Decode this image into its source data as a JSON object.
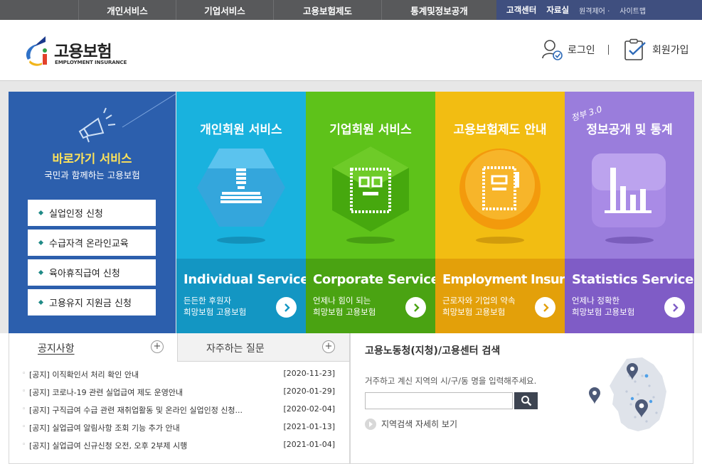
{
  "topnav": {
    "items": [
      "개인서비스",
      "기업서비스",
      "고용보험제도",
      "통계및정보공개"
    ],
    "util": {
      "customer": "고객센터",
      "data": "자료실",
      "remote": "원격제어",
      "sitemap": "사이트맵"
    }
  },
  "header": {
    "logo_ko": "고용보험",
    "logo_en": "EMPLOYMENT INSURANCE",
    "login": "로그인",
    "join": "회원가입"
  },
  "quick": {
    "title": "바로가기 서비스",
    "subtitle": "국민과 함께하는 고용보험",
    "buttons": [
      "실업인정 신청",
      "수급자격 온라인교육",
      "육아휴직급여 신청",
      "고용유지 지원금 신청"
    ]
  },
  "cards": [
    {
      "ko": "개인회원 서비스",
      "en": "Individual Service",
      "d1": "든든한 후원자",
      "d2": "희망보험 고용보험"
    },
    {
      "ko": "기업회원 서비스",
      "en": "Corporate Service",
      "d1": "언제나 힘이 되는",
      "d2": "희망보험 고용보험"
    },
    {
      "ko": "고용보험제도 안내",
      "en": "Employment Insurance",
      "d1": "근로자와 기업의 약속",
      "d2": "희망보험 고용보험"
    },
    {
      "ko": "정보공개 및 통계",
      "en": "Statistics Service",
      "d1": "언제나 정확한",
      "d2": "희망보험 고용보험",
      "badge": "정부 3.0"
    }
  ],
  "notice": {
    "tab1": "공지사항",
    "tab2": "자주하는 질문",
    "items": [
      {
        "title": "[공지] 이직확인서 처리 확인 안내",
        "date": "[2020-11-23]"
      },
      {
        "title": "[공지] 코로나-19 관련 실업급여 제도 운영안내",
        "date": "[2020-01-29]"
      },
      {
        "title": "[공지] 구직급여 수급 관련 재취업활동 및 온라인 실업인정 신청...",
        "date": "[2020-02-04]"
      },
      {
        "title": "[공지] 실업급여 알림사항 조회 기능 추가 안내",
        "date": "[2021-01-13]"
      },
      {
        "title": "[공지] 실업급여 신규신청 오전, 오후 2부제 시행",
        "date": "[2021-01-04]"
      }
    ]
  },
  "search": {
    "title": "고용노동청(지청)/고용센터 검색",
    "guide": "거주하고 계신 지역의 시/구/동 명을 입력해주세요.",
    "placeholder": "",
    "more": "지역검색 자세히 보기"
  },
  "colors": {
    "quick": "#2c5fad",
    "individual": "#17a9d6",
    "corporate": "#5bb317",
    "employment": "#f0b70e",
    "statistics": "#8e6fd6"
  }
}
